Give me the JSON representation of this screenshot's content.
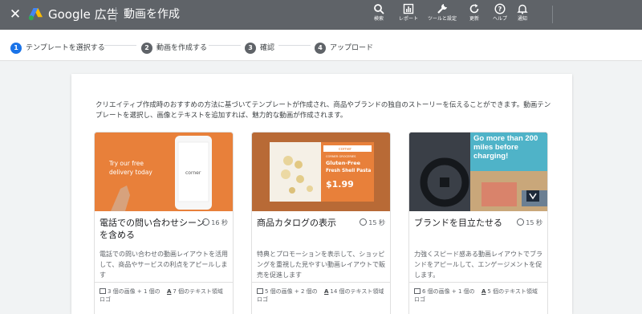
{
  "topbar": {
    "close_icon": "close-icon",
    "brand": "Google 広告",
    "page_title": "動画を作成",
    "tools": [
      {
        "icon": "search-icon",
        "label": "検索"
      },
      {
        "icon": "report-icon",
        "label": "レポート"
      },
      {
        "icon": "wrench-icon",
        "label": "ツールと設定"
      },
      {
        "icon": "refresh-icon",
        "label": "更新"
      },
      {
        "icon": "help-icon",
        "label": "ヘルプ"
      },
      {
        "icon": "bell-icon",
        "label": "通知"
      }
    ]
  },
  "stepper": {
    "steps": [
      {
        "num": "1",
        "label": "テンプレートを選択する",
        "active": true
      },
      {
        "num": "2",
        "label": "動画を作成する",
        "active": false
      },
      {
        "num": "3",
        "label": "確認",
        "active": false
      },
      {
        "num": "4",
        "label": "アップロード",
        "active": false
      }
    ]
  },
  "intro": "クリエイティブ作成時のおすすめの方法に基づいてテンプレートが作成され、商品やブランドの独自のストーリーを伝えることができます。動画テンプレートを選択し、画像とテキストを追加すれば、魅力的な動画が作成されます。",
  "cards": [
    {
      "title": "電話での問い合わせシーンを含める",
      "duration": "16 秒",
      "description": "電話での問い合わせの動画レイアウトを活用して、商品やサービスの利点をアピールします",
      "images_meta": "3 個の画像 + 1 個のロゴ",
      "text_meta": "7 個のテキスト領域",
      "thumb": {
        "line1": "Try our free",
        "line2": "delivery today",
        "brand": "corner"
      }
    },
    {
      "title": "商品カタログの表示",
      "duration": "15 秒",
      "description": "特典とプロモーションを表示して、ショッピングを重視した見やすい動画レイアウトで販売を促進します",
      "images_meta": "5 個の画像 + 2 個のロゴ",
      "text_meta": "14 個のテキスト領域",
      "thumb": {
        "brand": "corner",
        "store": "CORNER GROCERIES",
        "product_line1": "Gluten-Free",
        "product_line2": "Fresh Shell Pasta",
        "price": "$1.99"
      }
    },
    {
      "title": "ブランドを目立たせる",
      "duration": "15 秒",
      "description": "力強くスピード感ある動画レイアウトでブランドをアピールして、エンゲージメントを促します。",
      "images_meta": "6 個の画像 + 1 個のロゴ",
      "text_meta": "5 個のテキスト領域",
      "thumb": {
        "headline": "Go more than 200 miles before charging!"
      }
    }
  ],
  "colors": {
    "topbar": "#5f6368",
    "accent": "#1a73e8",
    "card_orange": "#e8803a",
    "teal": "#4fb3c8"
  }
}
